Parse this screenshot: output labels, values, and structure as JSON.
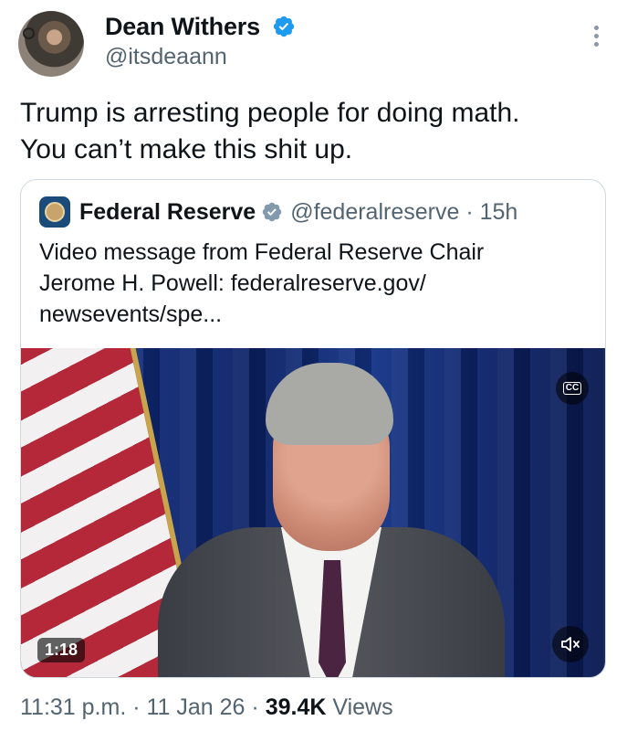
{
  "author": {
    "name": "Dean Withers",
    "handle": "@itsdeaann"
  },
  "tweet": {
    "lines": [
      "Trump is arresting people for doing math.",
      "You can’t make this shit up."
    ]
  },
  "quote": {
    "name": "Federal Reserve",
    "handle": "@federalreserve",
    "time": "· 15h",
    "lines": [
      "Video message from Federal Reserve Chair",
      "Jerome H. Powell: federalreserve.gov/",
      "newsevents/spe..."
    ],
    "video": {
      "duration": "1:18",
      "cc_label": "CC"
    }
  },
  "meta": {
    "time": "11:31 p.m.",
    "sep1": " · ",
    "date": "11 Jan 26",
    "sep2": " · ",
    "views_count": "39.4K",
    "views_label": " Views"
  },
  "colors": {
    "verified": "#1d9bf0",
    "secondary_text": "#536471",
    "primary_text": "#0f1419",
    "border": "#cfd9de"
  },
  "icons": [
    "verified-badge-icon",
    "more-options-icon",
    "closed-captions-icon",
    "muted-speaker-icon"
  ]
}
